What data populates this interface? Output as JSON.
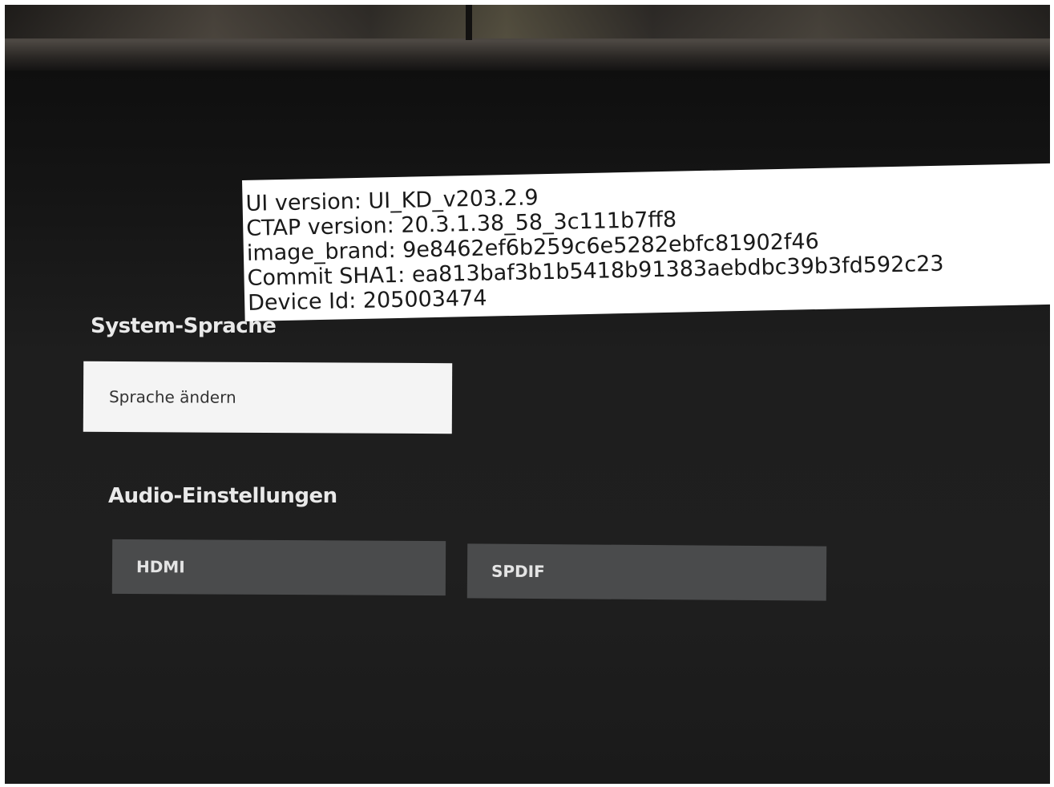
{
  "settings": {
    "system_language_title": "System-Sprache",
    "change_language_label": "Sprache ändern",
    "audio_settings_title": "Audio-Einstellungen",
    "audio_options": [
      "HDMI",
      "SPDIF"
    ]
  },
  "info_overlay": {
    "lines": [
      "UI version: UI_KD_v203.2.9",
      "CTAP version: 20.3.1.38_58_3c111b7ff8",
      "image_brand: 9e8462ef6b259c6e5282ebfc81902f46",
      "Commit SHA1: ea813baf3b1b5418b91383aebdbc39b3fd592c23",
      "Device Id: 205003474"
    ]
  },
  "colors": {
    "screen_background": "#1e1e1e",
    "focused_button": "#f4f4f4",
    "inactive_button": "#4a4b4c",
    "overlay_background": "#ffffff"
  }
}
